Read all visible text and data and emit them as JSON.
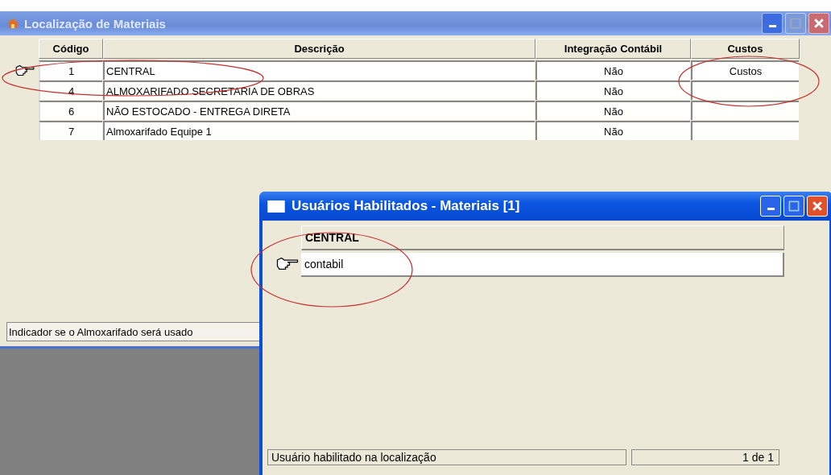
{
  "window": {
    "title": "Localização de Materiais"
  },
  "table": {
    "columns": [
      "Código",
      "Descrição",
      "Integração Contábil",
      "Custos"
    ],
    "rows": [
      {
        "selected": true,
        "cells": [
          "1",
          "CENTRAL",
          "Não",
          "Custos"
        ]
      },
      {
        "selected": false,
        "cells": [
          "4",
          "ALMOXARIFADO SECRETARIA DE OBRAS",
          "Não",
          ""
        ]
      },
      {
        "selected": false,
        "cells": [
          "6",
          "NÃO ESTOCADO - ENTREGA DIRETA",
          "Não",
          ""
        ]
      },
      {
        "selected": false,
        "cells": [
          "7",
          "Almoxarifado Equipe 1",
          "Não",
          ""
        ]
      }
    ]
  },
  "status_bar": "Indicador se o Almoxarifado será usado",
  "dialog": {
    "title": "Usuários Habilitados - Materiais [1]",
    "column": "CENTRAL",
    "rows": [
      {
        "selected": true,
        "text": "contabil"
      }
    ],
    "status": "Usuário habilitado na localização",
    "count": "1 de 1"
  }
}
